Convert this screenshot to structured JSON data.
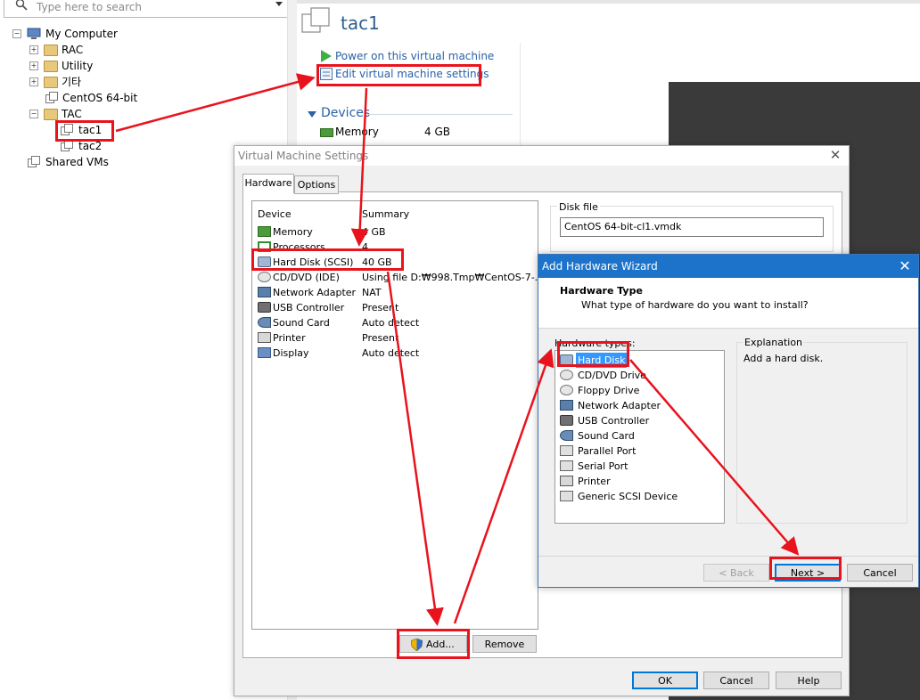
{
  "library": {
    "search_placeholder": "Type here to search",
    "tree": {
      "root": "My Computer",
      "rac": "RAC",
      "utility": "Utility",
      "gita": "기타",
      "centos": "CentOS 64-bit",
      "tac": "TAC",
      "tac1": "tac1",
      "tac2": "tac2",
      "shared": "Shared VMs"
    }
  },
  "vm": {
    "title": "tac1",
    "power_on": "Power on this virtual machine",
    "edit_settings": "Edit virtual machine settings",
    "devices_header": "Devices",
    "memory_label": "Memory",
    "memory_value": "4 GB"
  },
  "settings_dialog": {
    "title": "Virtual Machine Settings",
    "tabs": [
      "Hardware",
      "Options"
    ],
    "col_device": "Device",
    "col_summary": "Summary",
    "devices": [
      {
        "name": "Memory",
        "summary": "4 GB",
        "icon": "memory-icon"
      },
      {
        "name": "Processors",
        "summary": "4",
        "icon": "processor-icon"
      },
      {
        "name": "Hard Disk (SCSI)",
        "summary": "40 GB",
        "icon": "hard-disk-icon"
      },
      {
        "name": "CD/DVD (IDE)",
        "summary": "Using file D:₩998.Tmp₩CentOS-7-...",
        "icon": "cd-dvd-icon"
      },
      {
        "name": "Network Adapter",
        "summary": "NAT",
        "icon": "network-adapter-icon"
      },
      {
        "name": "USB Controller",
        "summary": "Present",
        "icon": "usb-icon"
      },
      {
        "name": "Sound Card",
        "summary": "Auto detect",
        "icon": "sound-card-icon"
      },
      {
        "name": "Printer",
        "summary": "Present",
        "icon": "printer-icon"
      },
      {
        "name": "Display",
        "summary": "Auto detect",
        "icon": "display-icon"
      }
    ],
    "disk_file_label": "Disk file",
    "disk_file_value": "CentOS 64-bit-cl1.vmdk",
    "add_button": "Add...",
    "remove_button": "Remove",
    "ok_button": "OK",
    "cancel_button": "Cancel",
    "help_button": "Help"
  },
  "wizard": {
    "title": "Add Hardware Wizard",
    "heading": "Hardware Type",
    "subheading": "What type of hardware do you want to install?",
    "hardware_types_label": "Hardware types:",
    "hardware_types": [
      {
        "name": "Hard Disk",
        "icon": "hard-disk-icon",
        "selected": true
      },
      {
        "name": "CD/DVD Drive",
        "icon": "cd-dvd-icon"
      },
      {
        "name": "Floppy Drive",
        "icon": "floppy-icon"
      },
      {
        "name": "Network Adapter",
        "icon": "network-adapter-icon"
      },
      {
        "name": "USB Controller",
        "icon": "usb-icon"
      },
      {
        "name": "Sound Card",
        "icon": "sound-card-icon"
      },
      {
        "name": "Parallel Port",
        "icon": "parallel-port-icon"
      },
      {
        "name": "Serial Port",
        "icon": "serial-port-icon"
      },
      {
        "name": "Printer",
        "icon": "printer-icon"
      },
      {
        "name": "Generic SCSI Device",
        "icon": "scsi-icon"
      }
    ],
    "explanation_label": "Explanation",
    "explanation_text": "Add a hard disk.",
    "back_button": "< Back",
    "next_button": "Next >",
    "cancel_button": "Cancel"
  },
  "colors": {
    "annotation": "#e8131c",
    "link": "#2a62a8",
    "wizard_titlebar": "#1c73c9",
    "selection": "#3399ff"
  }
}
